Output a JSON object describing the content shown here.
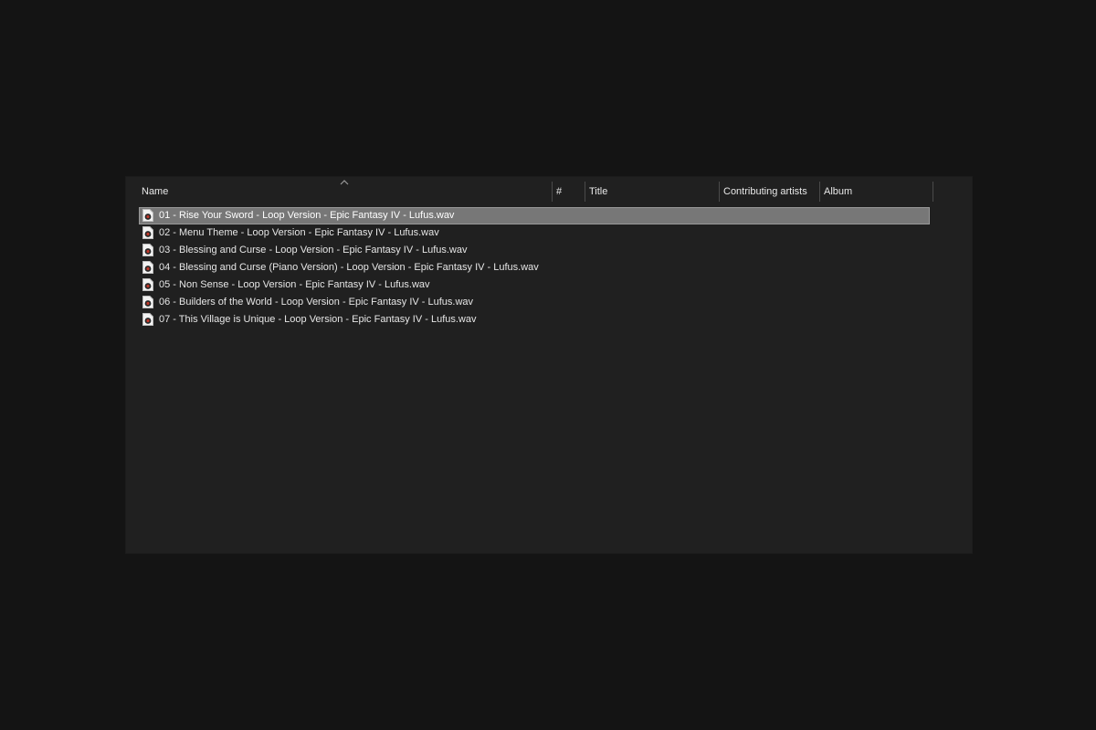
{
  "columns": {
    "name": "Name",
    "number": "#",
    "title": "Title",
    "contributing_artists": "Contributing artists",
    "album": "Album"
  },
  "sort": {
    "column": "name",
    "direction": "ascending",
    "indicator_icon": "sort-up-caret-icon"
  },
  "files": [
    {
      "name": "01 - Rise Your Sword - Loop Version - Epic Fantasy IV - Lufus.wav",
      "selected": true
    },
    {
      "name": "02 - Menu Theme - Loop Version - Epic Fantasy IV - Lufus.wav",
      "selected": false
    },
    {
      "name": "03 - Blessing and Curse - Loop Version - Epic Fantasy IV - Lufus.wav",
      "selected": false
    },
    {
      "name": "04 - Blessing and Curse (Piano Version) - Loop Version - Epic Fantasy IV - Lufus.wav",
      "selected": false
    },
    {
      "name": "05 - Non Sense - Loop Version - Epic Fantasy IV - Lufus.wav",
      "selected": false
    },
    {
      "name": "06 - Builders of the World - Loop Version - Epic Fantasy IV - Lufus.wav",
      "selected": false
    },
    {
      "name": "07 - This Village is Unique - Loop Version - Epic Fantasy IV - Lufus.wav",
      "selected": false
    }
  ],
  "file_icon": "audio-file-icon",
  "colors": {
    "background": "#141414",
    "pane": "#202020",
    "selection": "#777777",
    "text": "#e6e6e6"
  }
}
